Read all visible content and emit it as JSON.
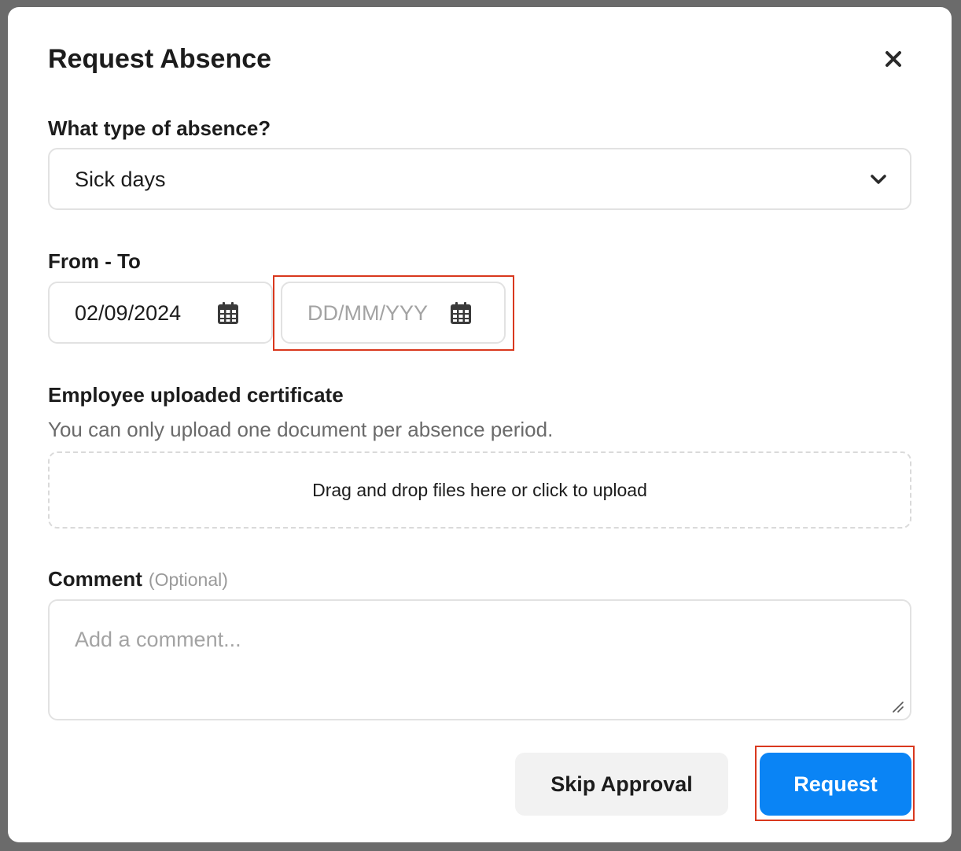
{
  "modal": {
    "title": "Request Absence",
    "close_icon": "close-icon"
  },
  "absence_type": {
    "label": "What type of absence?",
    "selected": "Sick days",
    "icon": "chevron-down-icon"
  },
  "dates": {
    "label": "From - To",
    "from_value": "02/09/2024",
    "to_placeholder": "DD/MM/YYY",
    "icon": "calendar-icon"
  },
  "certificate": {
    "label": "Employee uploaded certificate",
    "helper": "You can only upload one document per absence period.",
    "dropzone_text": "Drag and drop files here or click to upload"
  },
  "comment": {
    "label": "Comment",
    "optional": "(Optional)",
    "placeholder": "Add a comment..."
  },
  "actions": {
    "skip_label": "Skip Approval",
    "request_label": "Request"
  },
  "colors": {
    "primary": "#0a84f5",
    "highlight": "#d9381e",
    "secondary_button": "#f2f2f2"
  }
}
